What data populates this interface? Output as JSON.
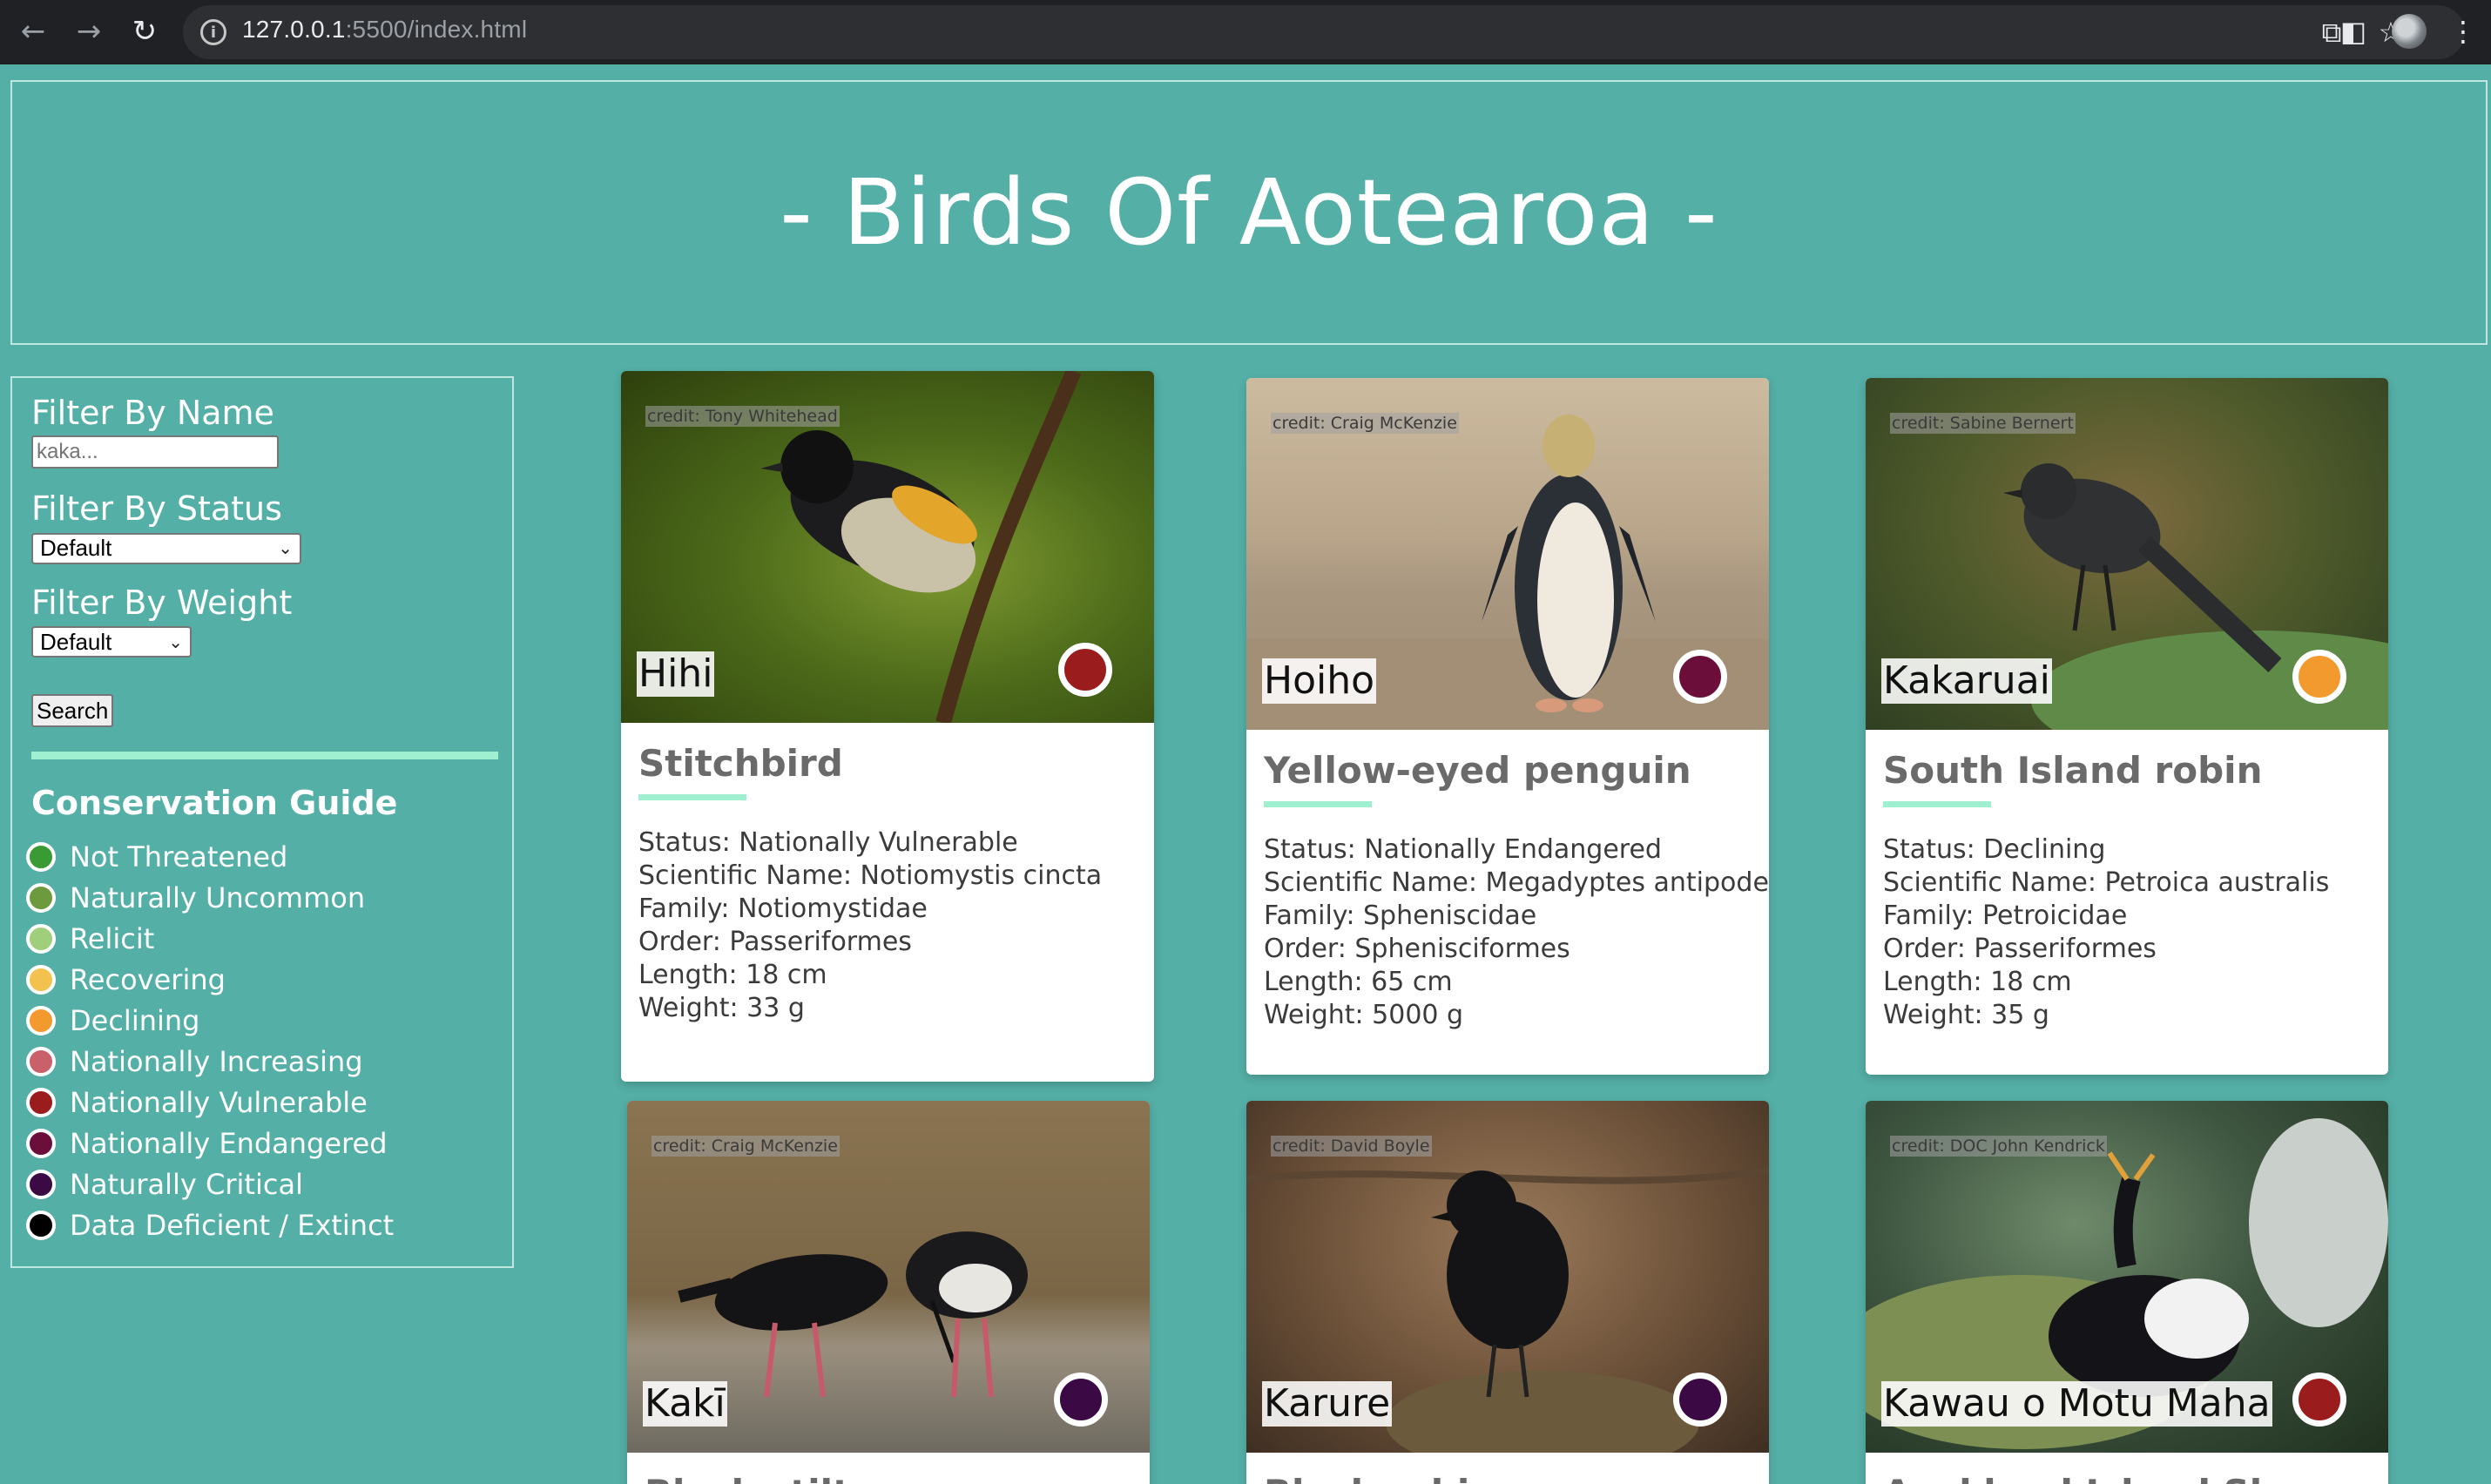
{
  "browser": {
    "url_host": "127.0.0.1",
    "url_rest": ":5500/index.html"
  },
  "header": {
    "title": "- Birds Of Aotearoa -"
  },
  "sidebar": {
    "filter_name_label": "Filter By Name",
    "name_placeholder": "kaka...",
    "filter_status_label": "Filter By Status",
    "status_selected": "Default",
    "filter_weight_label": "Filter By Weight",
    "weight_selected": "Default",
    "search_label": "Search",
    "guide_title": "Conservation Guide",
    "guide": [
      {
        "label": "Not Threatened",
        "color": "#3a9b35"
      },
      {
        "label": "Naturally Uncommon",
        "color": "#6d9a3c"
      },
      {
        "label": "Relicit",
        "color": "#9fcf7a"
      },
      {
        "label": "Recovering",
        "color": "#f2c14e"
      },
      {
        "label": "Declining",
        "color": "#f29a2e"
      },
      {
        "label": "Nationally Increasing",
        "color": "#c9606a"
      },
      {
        "label": "Nationally Vulnerable",
        "color": "#9b1c1c"
      },
      {
        "label": "Nationally Endangered",
        "color": "#6b0f3a"
      },
      {
        "label": "Naturally Critical",
        "color": "#3b0a45"
      },
      {
        "label": "Data Deficient / Extinct",
        "color": "#000000"
      }
    ]
  },
  "cards": [
    {
      "credit": "credit: Tony Whitehead",
      "maori_name": "Hihi",
      "english_name": "Stitchbird",
      "status_color": "#9b1c1c",
      "facts": [
        "Status: Nationally Vulnerable",
        "Scientific Name: Notiomystis cincta",
        "Family: Notiomystidae",
        "Order: Passeriformes",
        "Length: 18 cm",
        "Weight: 33 g"
      ]
    },
    {
      "credit": "credit: Craig McKenzie",
      "maori_name": "Hoiho",
      "english_name": "Yellow-eyed penguin",
      "status_color": "#6b0f3a",
      "facts": [
        "Status: Nationally Endangered",
        "Scientific Name: Megadyptes antipodes",
        "Family: Spheniscidae",
        "Order: Sphenisciformes",
        "Length: 65 cm",
        "Weight: 5000 g"
      ]
    },
    {
      "credit": "credit: Sabine Bernert",
      "maori_name": "Kakaruai",
      "english_name": "South Island robin",
      "status_color": "#f29a2e",
      "facts": [
        "Status: Declining",
        "Scientific Name: Petroica australis",
        "Family: Petroicidae",
        "Order: Passeriformes",
        "Length: 18 cm",
        "Weight: 35 g"
      ]
    },
    {
      "credit": "credit: Craig McKenzie",
      "maori_name": "Kakī",
      "english_name": "Black stilt",
      "status_color": "#3b0a45",
      "facts": []
    },
    {
      "credit": "credit: David Boyle",
      "maori_name": "Karure",
      "english_name": "Black robin",
      "status_color": "#3b0a45",
      "facts": []
    },
    {
      "credit": "credit: DOC John Kendrick",
      "maori_name": "Kawau o Motu Maha",
      "english_name": "Auckland Island Shag",
      "status_color": "#9b1c1c",
      "facts": []
    }
  ]
}
